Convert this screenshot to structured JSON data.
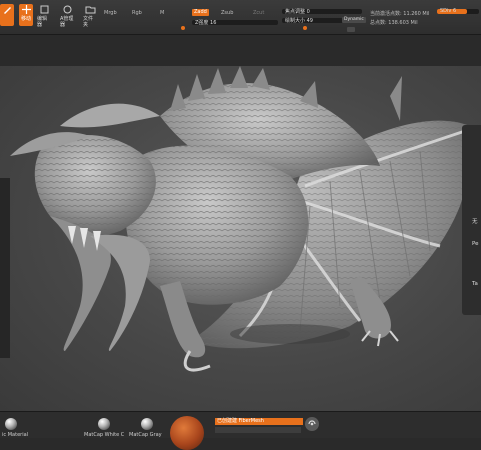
{
  "toolbar": {
    "buttons": [
      {
        "label": "",
        "icon": "brush-icon"
      },
      {
        "label": "移动",
        "icon": "move-icon"
      },
      {
        "label": "编辑器",
        "icon": "edit-icon"
      },
      {
        "label": "A管理器",
        "icon": "manager-icon"
      },
      {
        "label": "文件夹",
        "icon": "folder-icon"
      }
    ],
    "mrgb": "Mrgb",
    "rgb": "Rgb",
    "m": "M",
    "zadd": "Zadd",
    "zsub": "Zsub",
    "zcut": "Zcut",
    "z_intensity": "Z强度 16",
    "focal_shift": "焦点调整 0",
    "draw_size": "绘制大小 49",
    "dynamic": "Dynamic",
    "active_points": "当前激活点数: 11.260 Mil",
    "total_points": "总点数: 138.603 Mil",
    "sdiv": "SDiv 6"
  },
  "right_panel": {
    "items": [
      "无",
      "Pe",
      "Ta"
    ]
  },
  "bottom": {
    "materials": [
      {
        "label": "ic Material"
      },
      {
        "label": "MatCap White C"
      },
      {
        "label": "MatCap Gray"
      }
    ],
    "fiber_label": "已创建建 FiberMesh"
  },
  "colors": {
    "accent": "#e8711c",
    "bg": "#2a2a2a",
    "canvas": "#4a4a4a"
  }
}
